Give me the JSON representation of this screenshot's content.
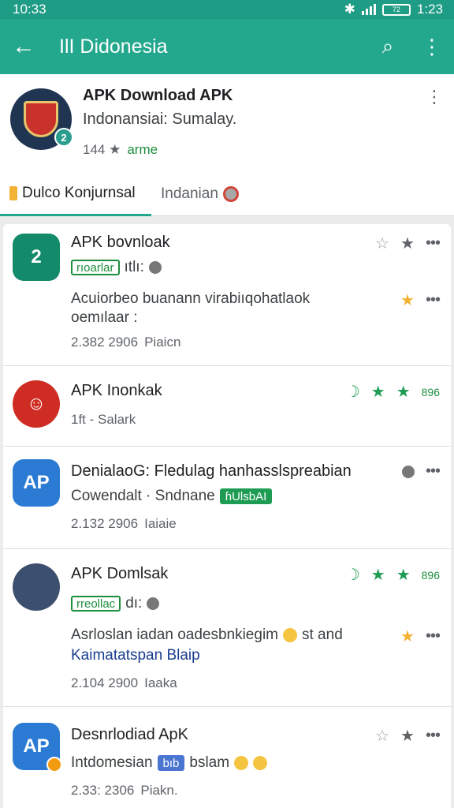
{
  "status": {
    "time": "10:33",
    "time_right": "1:23",
    "battery": "72"
  },
  "appbar": {
    "title": "IlI Didonesia"
  },
  "header": {
    "title": "APK Download APK",
    "subtitle": "Indonansiai: Sumalay.",
    "rating": "144 ★",
    "rating_label": "arme",
    "tabs": [
      "Dulco Konjurnsal",
      "Indanian"
    ]
  },
  "items": [
    {
      "name": "APK bovnloak",
      "chip": "rıoarlar",
      "chip2": "ıtlı:",
      "desc1": "Acuiorbeo buanann virabiıqohatlaok",
      "desc2": "oemılaar :",
      "meta1": "2.382  2906",
      "meta2": "Piaicn",
      "rating": ""
    },
    {
      "name": "APK Inonkak",
      "chip": "",
      "chip2": "",
      "desc1": "",
      "desc2": "",
      "meta1": "1ft - Salark",
      "meta2": "",
      "rating": "896"
    },
    {
      "name": "DenialaoG: Fledulag hanhasslspreabian",
      "chip": "",
      "chip2": "",
      "desc1": "Cowendalt · Sndnane",
      "desc2": "",
      "meta1": "2.132  2906",
      "meta2": "Iaiaie",
      "rating": "",
      "badge": "ɦUlsbAI"
    },
    {
      "name": "APK Domlsak",
      "chip": "rreollac",
      "chip2": "dı:",
      "desc1": "Asrloslan iadan oadesbnkiegim",
      "desc2": "Kaimatatspan Blaip",
      "meta1": "2.104  2900",
      "meta2": "Iaaka",
      "rating": "896",
      "after": "st and"
    },
    {
      "name": "Desnrlodiad ApK",
      "chip": "",
      "chip2": "",
      "desc1": "Intdomesian",
      "desc2": "",
      "meta1": "2.33:  2306",
      "meta2": "Piakn.",
      "rating": "",
      "badge": "bıb",
      "after": "bslam"
    }
  ]
}
